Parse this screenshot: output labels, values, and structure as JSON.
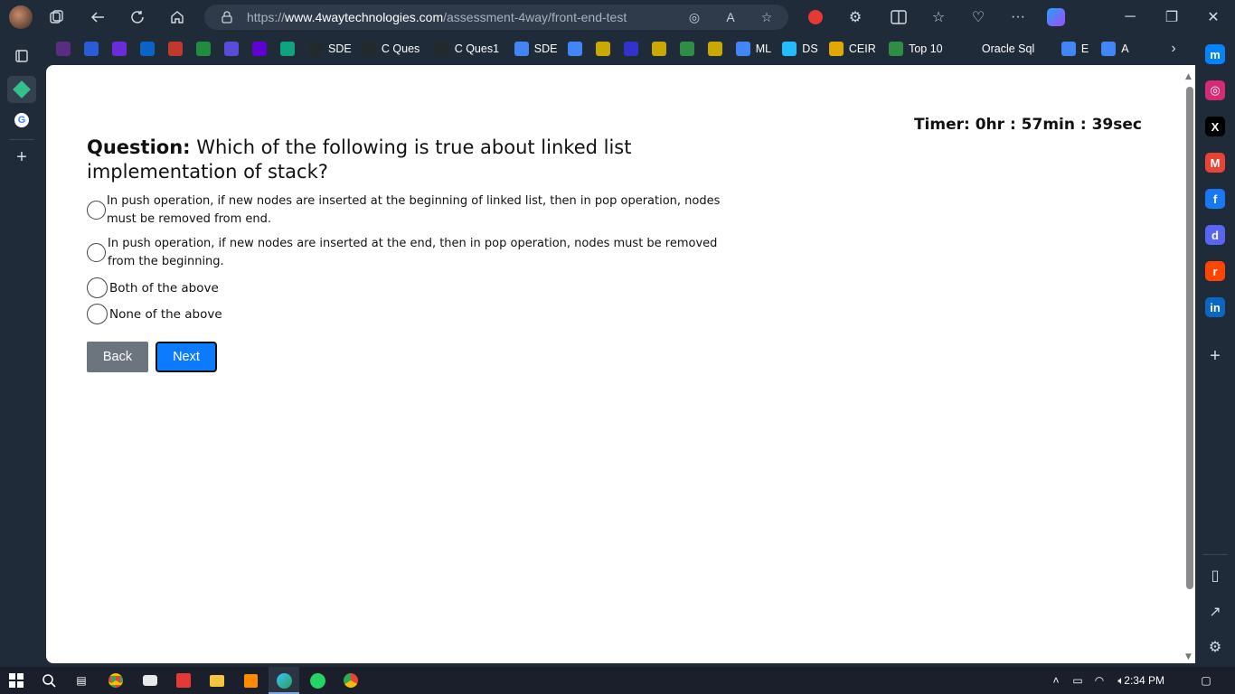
{
  "browser": {
    "url_prefix": "https://",
    "url_host": "www.4waytechnologies.com",
    "url_path": "/assessment-4way/front-end-test",
    "titlebar_icons": [
      "workspaces-icon",
      "back-icon",
      "refresh-icon",
      "home-icon"
    ],
    "window_controls": [
      "minimize-icon",
      "restore-icon",
      "close-icon"
    ]
  },
  "favorites": [
    {
      "label": "",
      "icon": "site-icon",
      "color": "#5b2c83"
    },
    {
      "label": "",
      "icon": "site-icon",
      "color": "#2b5cd8"
    },
    {
      "label": "",
      "icon": "tq-icon",
      "color": "#6a2bd8"
    },
    {
      "label": "",
      "icon": "outlook-icon",
      "color": "#0a64c8"
    },
    {
      "label": "",
      "icon": "gmail-icon",
      "color": "#c0392b"
    },
    {
      "label": "",
      "icon": "sheets-icon",
      "color": "#1e8e3e"
    },
    {
      "label": "",
      "icon": "site-icon",
      "color": "#5a4bd8"
    },
    {
      "label": "",
      "icon": "yahoo-icon",
      "color": "#6001d2"
    },
    {
      "label": "",
      "icon": "chatgpt-icon",
      "color": "#10a37f"
    },
    {
      "label": "SDE",
      "icon": "github-icon",
      "color": "#24292e"
    },
    {
      "label": "C Ques",
      "icon": "github-icon",
      "color": "#24292e"
    },
    {
      "label": "C Ques1",
      "icon": "github-icon",
      "color": "#24292e"
    },
    {
      "label": "SDE",
      "icon": "google-icon",
      "color": "#4285f4"
    },
    {
      "label": "",
      "icon": "google-icon",
      "color": "#4285f4"
    },
    {
      "label": "",
      "icon": "site-icon",
      "color": "#c9a800"
    },
    {
      "label": "",
      "icon": "site-icon",
      "color": "#3333cc"
    },
    {
      "label": "",
      "icon": "site-icon",
      "color": "#c9a800"
    },
    {
      "label": "",
      "icon": "gfg-icon",
      "color": "#2f8d46"
    },
    {
      "label": "",
      "icon": "site-icon",
      "color": "#c9a800"
    },
    {
      "label": "ML",
      "icon": "google-icon",
      "color": "#4285f4"
    },
    {
      "label": "DS",
      "icon": "kaggle-icon",
      "color": "#20beff"
    },
    {
      "label": "CEIR",
      "icon": "site-icon",
      "color": "#e0a800"
    },
    {
      "label": "Top 10",
      "icon": "gfg-icon",
      "color": "#2f8d46"
    },
    {
      "label": "Oracle Sql",
      "icon": "page-icon",
      "color": "#202b3a"
    },
    {
      "label": "E",
      "icon": "google-icon",
      "color": "#4285f4"
    },
    {
      "label": "A",
      "icon": "google-icon",
      "color": "#4285f4"
    }
  ],
  "right_sidebar": [
    {
      "icon": "messenger-icon",
      "color": "#0084ff",
      "glyph": "m"
    },
    {
      "icon": "instagram-icon",
      "color": "#d62976",
      "glyph": "◎"
    },
    {
      "icon": "x-icon",
      "color": "#000000",
      "glyph": "X"
    },
    {
      "icon": "gmail-icon",
      "color": "#ea4335",
      "glyph": "M"
    },
    {
      "icon": "facebook-icon",
      "color": "#1877f2",
      "glyph": "f"
    },
    {
      "icon": "discord-icon",
      "color": "#5865f2",
      "glyph": "d"
    },
    {
      "icon": "reddit-icon",
      "color": "#ff4500",
      "glyph": "r"
    },
    {
      "icon": "linkedin-icon",
      "color": "#0a66c2",
      "glyph": "in"
    },
    {
      "icon": "add-icon",
      "color": "transparent",
      "glyph": "+"
    }
  ],
  "test": {
    "timer": "Timer: 0hr : 57min : 39sec",
    "question_label": "Question:",
    "question_text": " Which of the following is true about linked list implementation of stack?",
    "options": [
      "In push operation, if new nodes are inserted at the beginning of linked list, then in pop operation, nodes must be removed from end.",
      "In push operation, if new nodes are inserted at the end, then in pop operation, nodes must be removed from the beginning.",
      "Both of the above",
      "None of the above"
    ],
    "back_label": "Back",
    "next_label": "Next"
  },
  "taskbar": {
    "time": "2:34 PM"
  },
  "colors": {
    "next_button": "#0d7bff",
    "back_button": "#6c757d",
    "browser_chrome": "#202b3a"
  }
}
